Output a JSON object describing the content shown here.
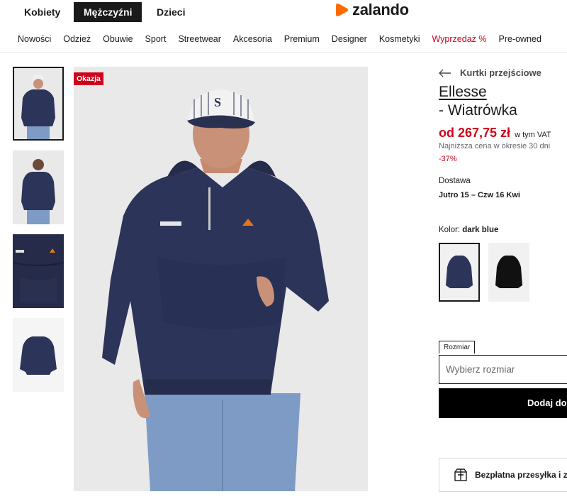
{
  "gender_tabs": [
    "Kobiety",
    "Mężczyźni",
    "Dzieci"
  ],
  "logo_text": "zalando",
  "categories": [
    "Nowości",
    "Odzież",
    "Obuwie",
    "Sport",
    "Streetwear",
    "Akcesoria",
    "Premium",
    "Designer",
    "Kosmetyki",
    "Wyprzedaż %",
    "Pre-owned"
  ],
  "badge": "Okazja",
  "product": {
    "breadcrumb": "Kurtki przejściowe",
    "brand": "Ellesse",
    "name": "- Wiatrówka",
    "price": "od 267,75 zł",
    "vat": "w tym VAT",
    "lowest_price_note": "Najniższa cena w okresie 30 dni",
    "discount": "-37%",
    "delivery_label": "Dostawa",
    "delivery_value": "Jutro 15 – Czw 16 Kwi",
    "color_label": "Kolor:",
    "color_value": "dark blue",
    "size_label": "Rozmiar",
    "size_placeholder": "Wybierz rozmiar",
    "add_button": "Dodaj do",
    "shipping": "Bezpłatna przesyłka i z"
  },
  "colors": {
    "accent": "#d0021b",
    "logo": "#ff6900",
    "jacket": "#2d3459",
    "text": "#1a1a1a"
  }
}
